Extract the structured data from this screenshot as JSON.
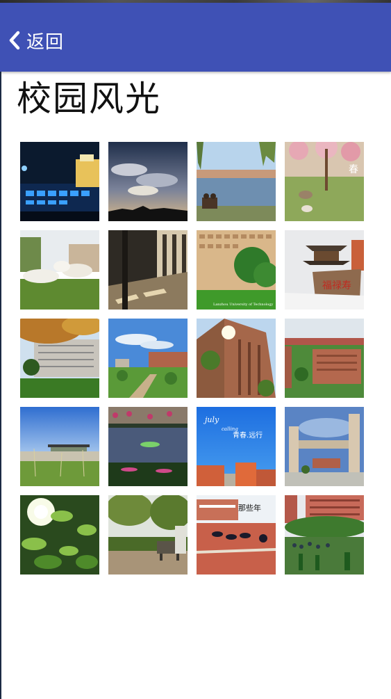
{
  "header": {
    "back_label": "返回",
    "back_icon": "chevron-left-icon",
    "bar_color": "#3f51b5"
  },
  "page": {
    "title": "校园风光"
  },
  "gallery": {
    "photos": [
      {
        "name": "photo-night-building"
      },
      {
        "name": "photo-cloudy-sky"
      },
      {
        "name": "photo-lake-willows"
      },
      {
        "name": "photo-peach-blossom-geese",
        "caption": "春"
      },
      {
        "name": "photo-white-geese-lawn"
      },
      {
        "name": "photo-corridor-shadows"
      },
      {
        "name": "photo-dormitory-trees",
        "caption": "Lanzhou University of Technology"
      },
      {
        "name": "photo-pavilion-rock",
        "caption": "福禄寿"
      },
      {
        "name": "photo-autumn-tree-building"
      },
      {
        "name": "photo-blue-sky-campus"
      },
      {
        "name": "photo-sunlit-tower"
      },
      {
        "name": "photo-campus-aerial"
      },
      {
        "name": "photo-stadium-grass"
      },
      {
        "name": "photo-lotus-pond"
      },
      {
        "name": "photo-youth-poster",
        "caption_1": "july",
        "caption_2": "calling",
        "caption_3": "青春.远行"
      },
      {
        "name": "photo-campus-gate"
      },
      {
        "name": "photo-ginkgo-sunlight"
      },
      {
        "name": "photo-bench-trees"
      },
      {
        "name": "photo-graduation-track",
        "caption": "那些年"
      },
      {
        "name": "photo-crowd-buildings"
      }
    ]
  }
}
